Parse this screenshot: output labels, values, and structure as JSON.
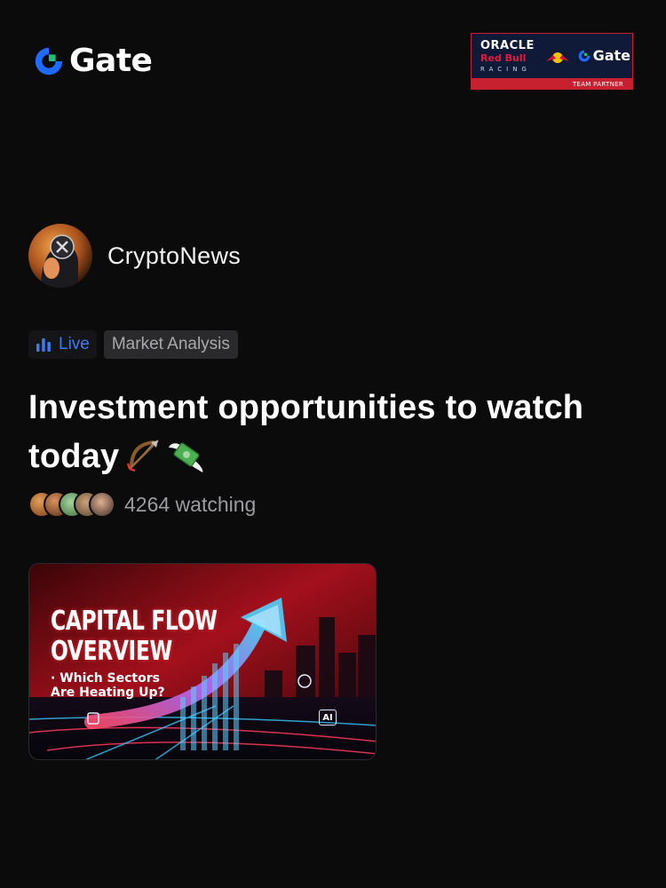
{
  "header": {
    "brand": "Gate",
    "partner": {
      "oracle": "ORACLE",
      "redbull": "Red Bull",
      "racing": "RACING",
      "gate": "Gate",
      "label": "TEAM PARTNER"
    }
  },
  "author": {
    "name": "CryptoNews"
  },
  "tags": {
    "live": "Live",
    "category": "Market Analysis"
  },
  "post": {
    "title": "Investment opportunities to watch today",
    "emoji_icons": [
      "bow-and-arrow-icon",
      "money-with-wings-icon"
    ]
  },
  "watching": {
    "count": 4264,
    "text": "4264 watching"
  },
  "thumbnail": {
    "headline_line1": "CAPITAL FLOW",
    "headline_line2": "OVERVIEW",
    "sub_line1": "· Which Sectors",
    "sub_line2": "Are Heating Up?",
    "ai_badge": "AI"
  },
  "colors": {
    "background": "#0b0b0c",
    "live_blue": "#3c7bf0",
    "gate_blue": "#1f6bff",
    "gate_green": "#19c27a",
    "partner_red": "#c7202e"
  }
}
